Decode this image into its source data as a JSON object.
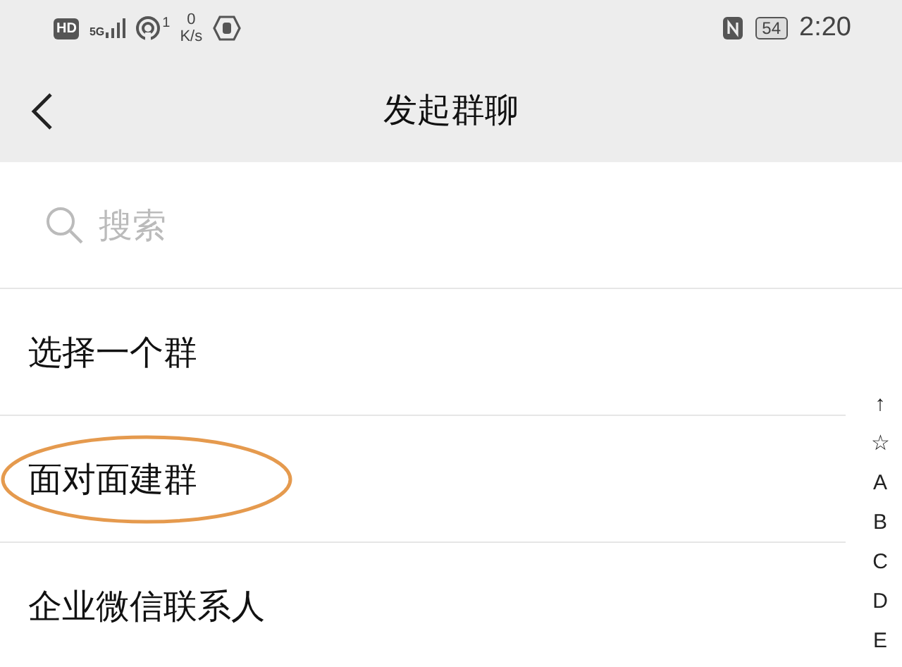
{
  "status_bar": {
    "hd": "HD",
    "network": "5G",
    "hotspot_count": "1",
    "speed_value": "0",
    "speed_unit": "K/s",
    "battery": "54",
    "time": "2:20"
  },
  "header": {
    "title": "发起群聊"
  },
  "search": {
    "placeholder": "搜索"
  },
  "rows": [
    {
      "label": "选择一个群",
      "circled": false
    },
    {
      "label": "面对面建群",
      "circled": true
    },
    {
      "label": "企业微信联系人",
      "circled": false
    }
  ],
  "index_bar": [
    "↑",
    "☆",
    "A",
    "B",
    "C",
    "D",
    "E"
  ]
}
